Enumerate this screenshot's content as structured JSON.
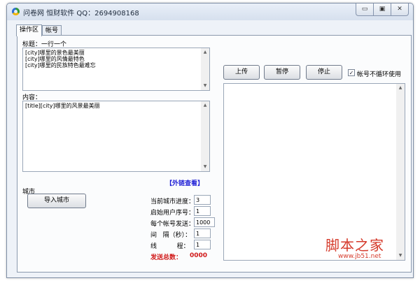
{
  "window": {
    "title": "问卷网  恒财软件 QQ：2694908168",
    "controls": {
      "minimize": "▭",
      "restore": "▣",
      "close": "✕"
    }
  },
  "tabs": [
    {
      "label": "操作区",
      "active": true
    },
    {
      "label": "帐号",
      "active": false
    }
  ],
  "operation": {
    "title_label": "标题：一行一个",
    "title_text": "[city]哪里的景色最美丽\n[city]哪里的风情最特色\n[city]哪里的民族特色最难忘",
    "content_label": "内容：",
    "content_text": "[title][city]哪里的风景最美丽",
    "external_link": "【外链查看】",
    "city_label": "城市",
    "import_city_button": "导入城市",
    "fields": [
      {
        "label": "当前城市进度：",
        "value": "3"
      },
      {
        "label": "启始用户序号：",
        "value": "1"
      },
      {
        "label": "每个帐号发送：",
        "value": "1000"
      },
      {
        "label": "间   隔（秒）：",
        "value": "1"
      },
      {
        "label": "线          程：",
        "value": "1"
      }
    ],
    "total_sent_label": "发送总数：",
    "total_sent_value": "0000"
  },
  "actions": {
    "upload_button": "上传",
    "pause_button": "暂停",
    "stop_button": "停止",
    "no_loop_checkbox_label": "帐号不循环使用",
    "no_loop_checked": true
  },
  "watermark": {
    "main": "脚本之家",
    "sub": "www.jb51.net"
  }
}
